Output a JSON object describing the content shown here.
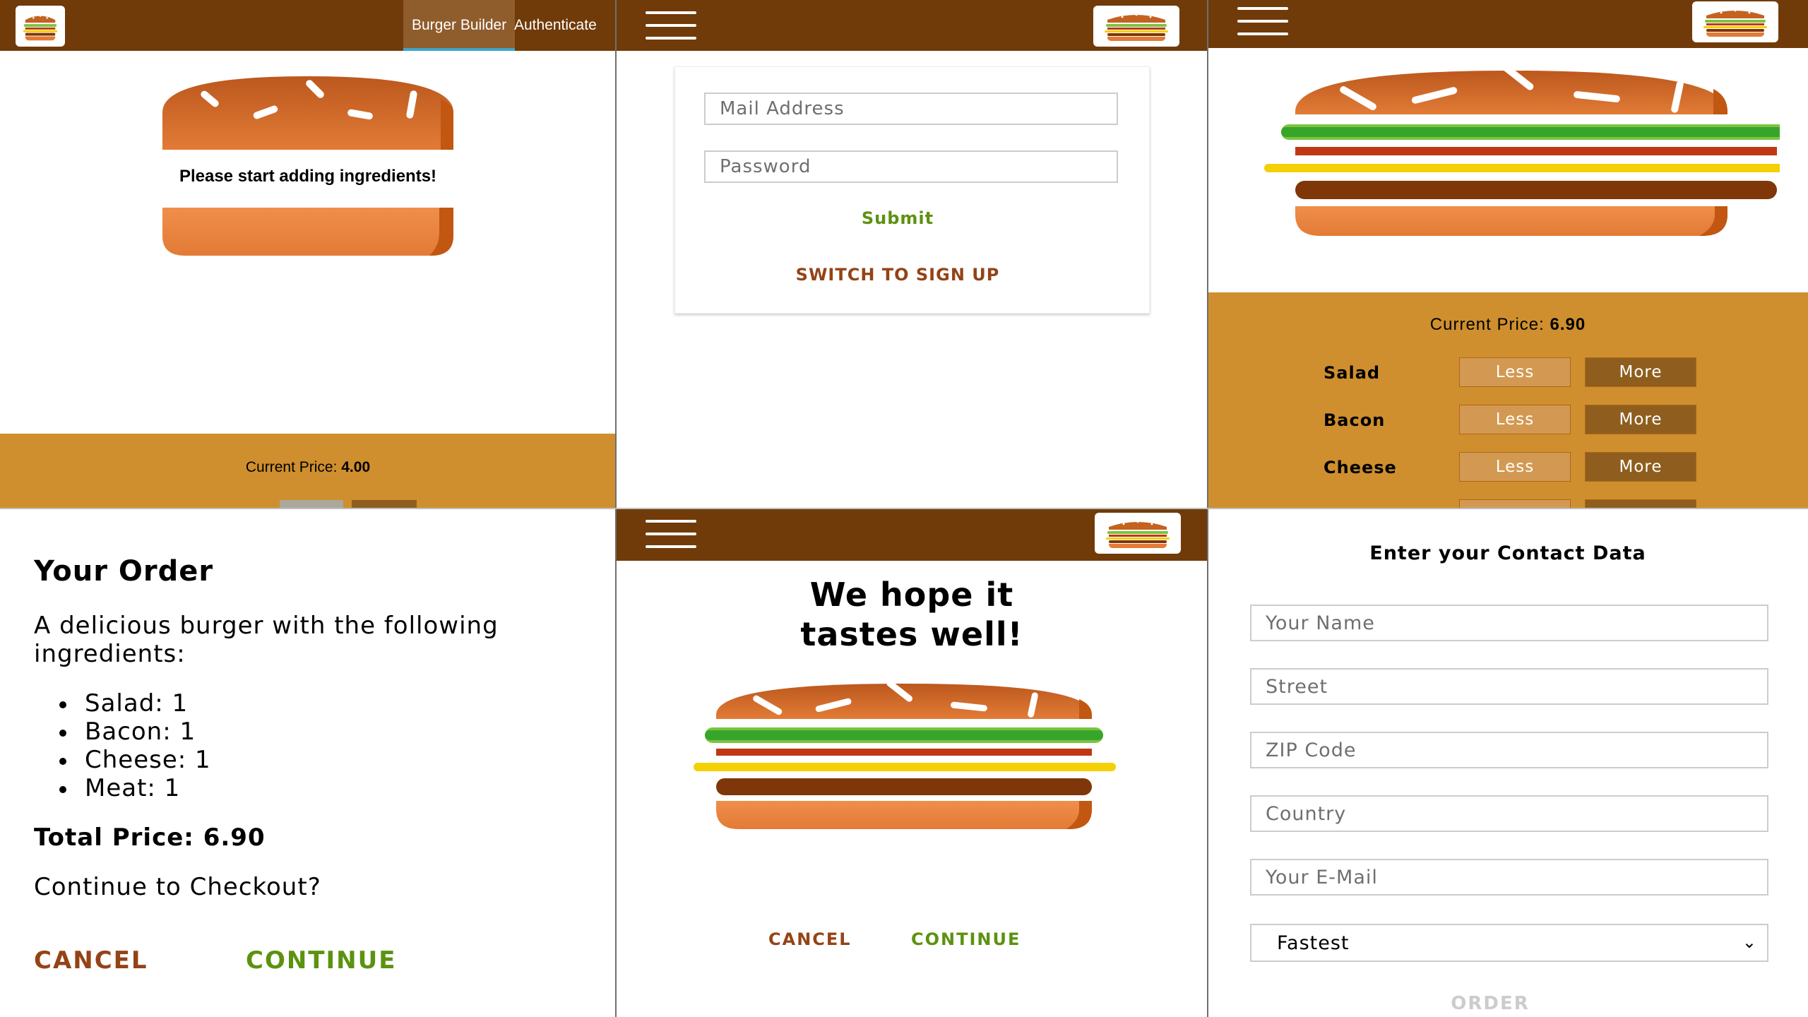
{
  "panel1": {
    "nav": {
      "burger_builder": "Burger Builder",
      "authenticate": "Authenticate"
    },
    "message": "Please start adding ingredients!",
    "price_label": "Current Price: ",
    "price_value": "4.00"
  },
  "panel2": {
    "email_placeholder": "Mail Address",
    "password_placeholder": "Password",
    "submit_label": "Submit",
    "switch_label": "SWITCH TO SIGN UP"
  },
  "panel3": {
    "price_label": "Current Price: ",
    "price_value": "6.90",
    "controls": [
      {
        "label": "Salad",
        "less": "Less",
        "more": "More"
      },
      {
        "label": "Bacon",
        "less": "Less",
        "more": "More"
      },
      {
        "label": "Cheese",
        "less": "Less",
        "more": "More"
      }
    ]
  },
  "panel4": {
    "title": "Your Order",
    "description": "A delicious burger with the following ingredients:",
    "ingredients": [
      "Salad: 1",
      "Bacon: 1",
      "Cheese: 1",
      "Meat: 1"
    ],
    "total_label": "Total Price: ",
    "total_value": "6.90",
    "question": "Continue to Checkout?",
    "cancel_label": "CANCEL",
    "continue_label": "CONTINUE"
  },
  "panel5": {
    "title": "We hope it tastes well!",
    "cancel_label": "CANCEL",
    "continue_label": "CONTINUE"
  },
  "panel6": {
    "title": "Enter your Contact Data",
    "fields": [
      "Your Name",
      "Street",
      "ZIP Code",
      "Country",
      "Your E-Mail"
    ],
    "delivery_selected": "Fastest",
    "order_label": "ORDER"
  },
  "colors": {
    "toolbar": "#703b09",
    "build_controls": "#cf8f2e",
    "success": "#5c9210",
    "danger": "#944317",
    "less_button": "#d39952",
    "more_button": "#8f5e1e"
  },
  "icons": [
    "burger-logo-icon",
    "menu-icon",
    "chevron-down-icon"
  ]
}
